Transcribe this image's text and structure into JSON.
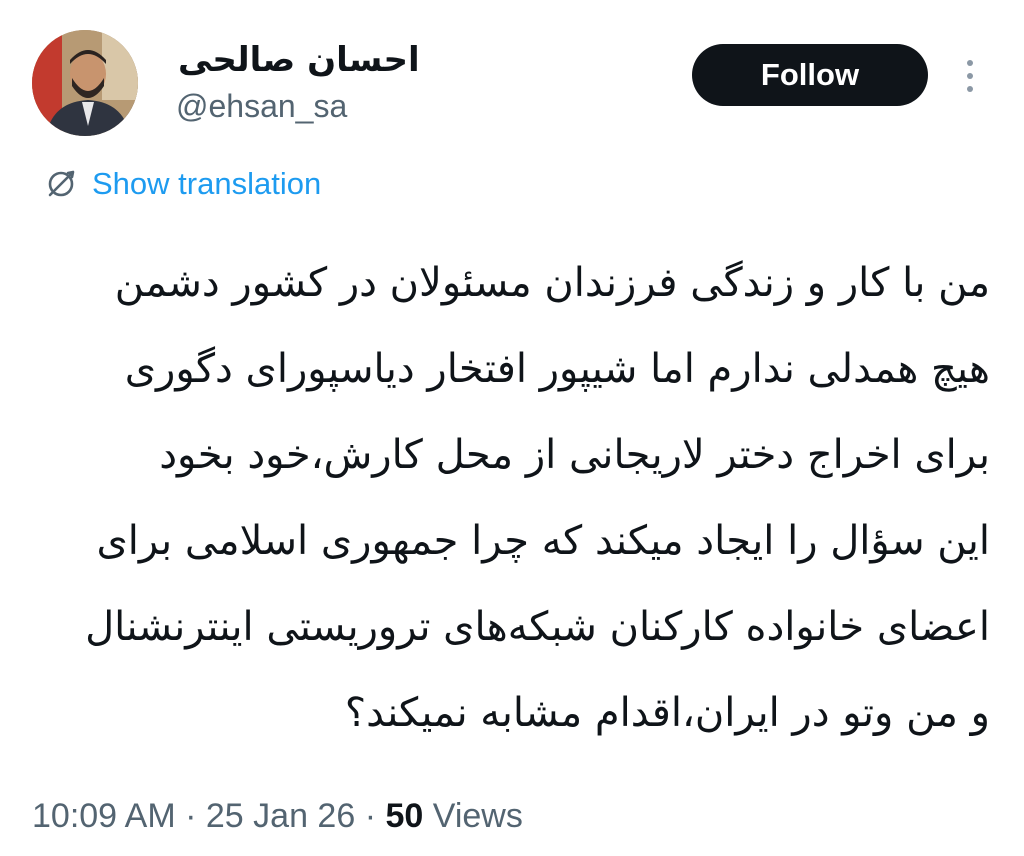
{
  "author": {
    "display_name": "احسان صالحی",
    "handle": "@ehsan_sa",
    "avatar_icon": "profile-photo"
  },
  "actions": {
    "follow_label": "Follow",
    "more_icon": "vertical-ellipsis-icon"
  },
  "translation": {
    "icon": "globe-icon",
    "label": "Show translation",
    "color": "#1d9bf0"
  },
  "tweet": {
    "lines": [
      "من با کار و زندگی فرزندان مسئولان در کشور دشمن",
      "هیچ همدلی ندارم اما شیپور افتخار دیاسپورای دگوری",
      "برای اخراج دختر لاریجانی از محل کارش،خود بخود",
      "این سؤال را ایجاد میکند که چرا جمهوری اسلامی برای",
      "اعضای خانواده کارکنان شبکه‌های تروریستی اینترنشنال",
      "و من وتو در ایران،اقدام مشابه نمیکند؟"
    ]
  },
  "meta": {
    "time": "10:09 AM",
    "separator": "·",
    "date": "25 Jan 26",
    "views_count": "50",
    "views_label": "Views"
  },
  "colors": {
    "text_primary": "#0f1419",
    "text_secondary": "#536471",
    "follow_bg": "#0f1419",
    "follow_text": "#ffffff"
  }
}
